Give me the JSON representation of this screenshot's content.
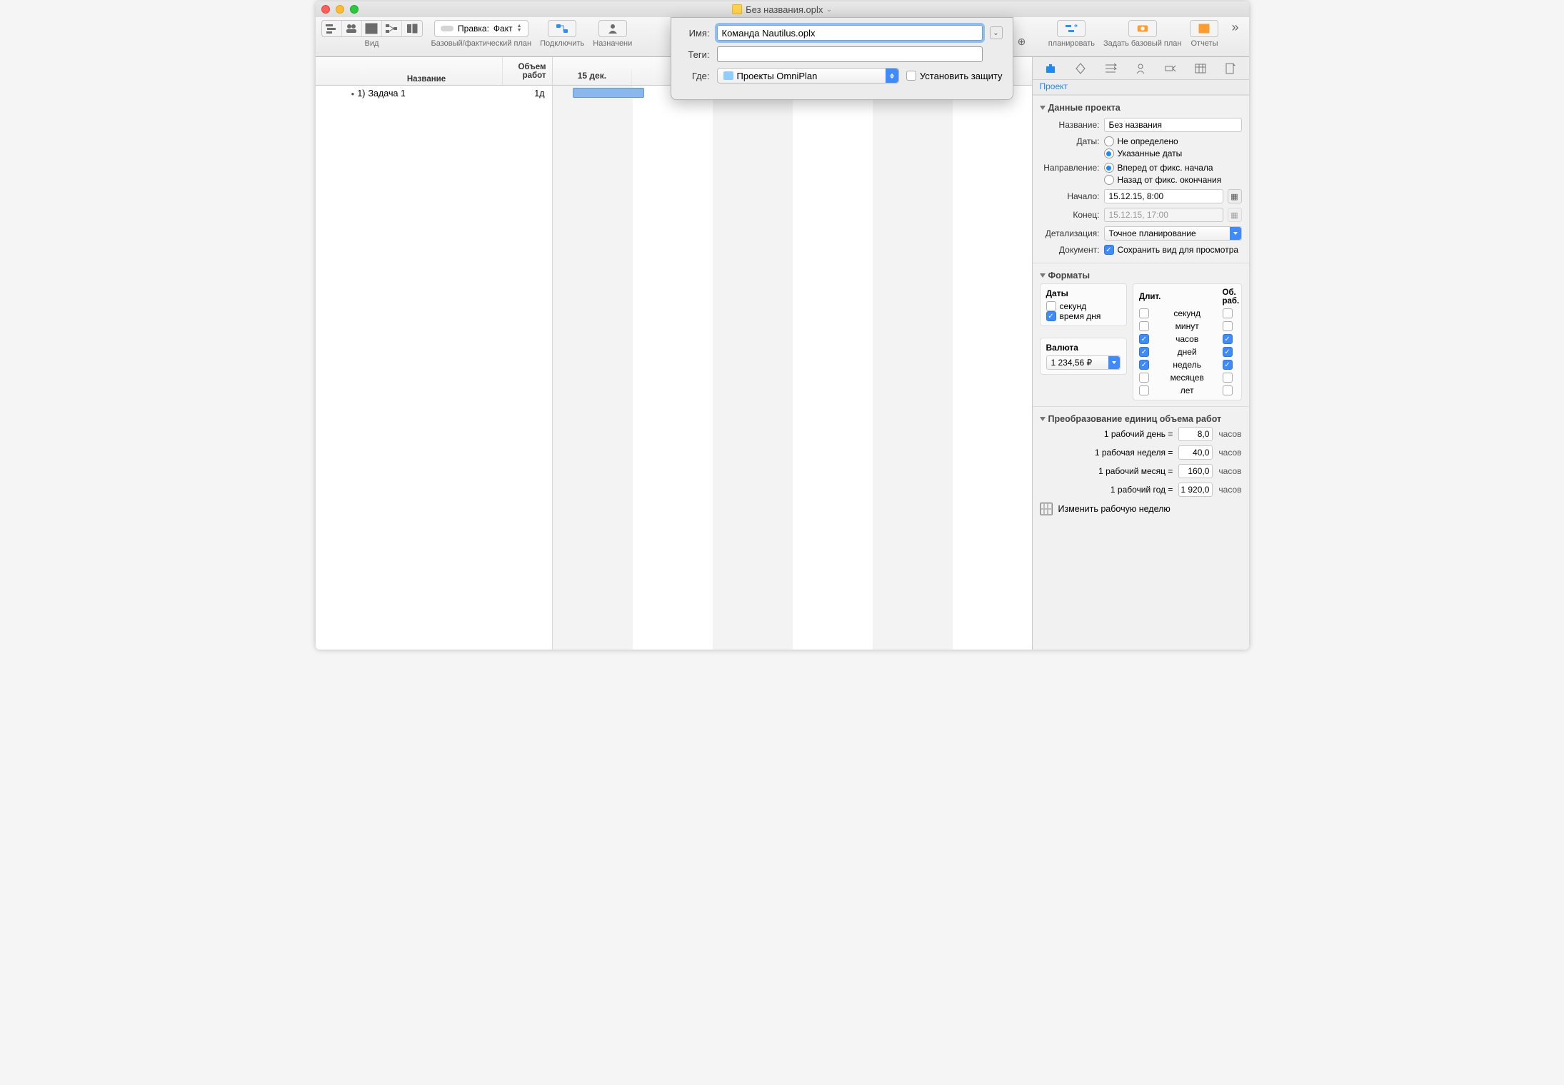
{
  "window": {
    "title": "Без названия.oplx"
  },
  "toolbar": {
    "view_label": "Вид",
    "edit_pill_prefix": "Правка:",
    "edit_pill_value": "Факт",
    "baseline_label": "Базовый/фактический план",
    "connect_label": "Подключить",
    "assign_label": "Назначени",
    "replan_label": "планировать",
    "set_baseline_label": "Задать базовый план",
    "reports_label": "Отчеты"
  },
  "task_table": {
    "col_name": "Название",
    "col_volume_l1": "Объем",
    "col_volume_l2": "работ",
    "rows": [
      {
        "index": "1)",
        "name": "Задача 1",
        "effort": "1д"
      }
    ]
  },
  "gantt": {
    "date_header": "15 дек."
  },
  "save_sheet": {
    "name_label": "Имя:",
    "name_value": "Команда Nautilus.oplx",
    "tags_label": "Теги:",
    "tags_value": "",
    "where_label": "Где:",
    "where_value": "Проекты OmniPlan",
    "protect_label": "Установить защиту"
  },
  "inspector": {
    "title": "Проект",
    "sec_project": "Данные проекта",
    "proj": {
      "name_label": "Название:",
      "name_value": "Без названия",
      "dates_label": "Даты:",
      "dates_opt1": "Не определено",
      "dates_opt2": "Указанные даты",
      "dir_label": "Направление:",
      "dir_opt1": "Вперед от фикс. начала",
      "dir_opt2": "Назад от фикс. окончания",
      "start_label": "Начало:",
      "start_value": "15.12.15, 8:00",
      "end_label": "Конец:",
      "end_value": "15.12.15, 17:00",
      "detail_label": "Детализация:",
      "detail_value": "Точное планирование",
      "doc_label": "Документ:",
      "doc_cb": "Сохранить вид для просмотра"
    },
    "sec_formats": "Форматы",
    "fmt": {
      "dates_head": "Даты",
      "seconds": "секунд",
      "timeofday": "время дня",
      "currency_head": "Валюта",
      "currency_value": "1 234,56 ₽",
      "dur_head": "Длит.",
      "vol_head": "Об. раб.",
      "u_sec": "секунд",
      "u_min": "минут",
      "u_hr": "часов",
      "u_day": "дней",
      "u_wk": "недель",
      "u_mo": "месяцев",
      "u_yr": "лет"
    },
    "sec_conv": "Преобразование единиц объема работ",
    "conv": {
      "r1_lbl": "1 рабочий день =",
      "r1_val": "8,0",
      "r1_u": "часов",
      "r2_lbl": "1 рабочая неделя =",
      "r2_val": "40,0",
      "r2_u": "часов",
      "r3_lbl": "1 рабочий месяц =",
      "r3_val": "160,0",
      "r3_u": "часов",
      "r4_lbl": "1 рабочий год =",
      "r4_val": "1 920,0",
      "r4_u": "часов"
    },
    "change_week": "Изменить рабочую неделю"
  }
}
